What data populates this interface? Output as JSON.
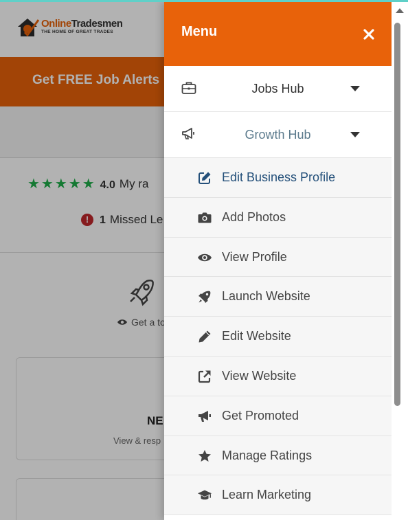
{
  "background": {
    "logo": {
      "name_part1": "Online",
      "name_part2": "Tradesmen",
      "tagline": "THE HOME OF GREAT TRADES"
    },
    "alert_bar": {
      "text": "Get FREE Job Alerts"
    },
    "rating": {
      "value": "4.0",
      "label": "My ra"
    },
    "missed": {
      "count": "1",
      "label": "Missed Le"
    },
    "tour": {
      "label": "Get a to"
    },
    "card": {
      "title": "NE",
      "subtitle": "View & resp"
    }
  },
  "menu": {
    "title": "Menu",
    "close_icon": "close-icon",
    "hubs": [
      {
        "label": "Jobs Hub",
        "icon": "briefcase-icon"
      },
      {
        "label": "Growth Hub",
        "icon": "megaphone-icon"
      }
    ],
    "growth_items": [
      {
        "label": "Edit Business Profile",
        "icon": "edit-square-icon"
      },
      {
        "label": "Add Photos",
        "icon": "camera-icon"
      },
      {
        "label": "View Profile",
        "icon": "eye-icon"
      },
      {
        "label": "Launch Website",
        "icon": "rocket-icon"
      },
      {
        "label": "Edit Website",
        "icon": "pencil-icon"
      },
      {
        "label": "View Website",
        "icon": "external-link-icon"
      },
      {
        "label": "Get Promoted",
        "icon": "bullhorn-icon"
      },
      {
        "label": "Manage Ratings",
        "icon": "star-icon"
      },
      {
        "label": "Learn Marketing",
        "icon": "graduation-cap-icon"
      }
    ]
  },
  "colors": {
    "brand_orange": "#e8620a",
    "star_green": "#1fae4a",
    "alert_red": "#c0282b",
    "active_hub_text": "#5b7a8c",
    "current_item_text": "#24507a"
  }
}
